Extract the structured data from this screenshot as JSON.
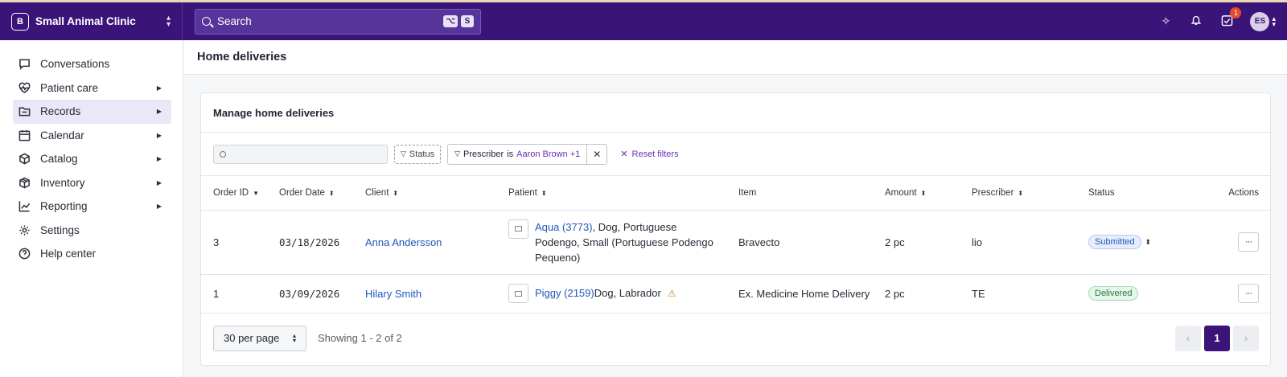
{
  "brand": {
    "logo": "B",
    "name": "Small Animal Clinic"
  },
  "search": {
    "placeholder": "Search",
    "shortcut": [
      "⌥",
      "S"
    ]
  },
  "topbar": {
    "tasks_badge": "1",
    "avatar_initials": "ES"
  },
  "sidebar": {
    "items": [
      {
        "label": "Conversations",
        "icon": "chat-icon",
        "has_submenu": false
      },
      {
        "label": "Patient care",
        "icon": "heart-pulse-icon",
        "has_submenu": true
      },
      {
        "label": "Records",
        "icon": "records-icon",
        "has_submenu": true,
        "active": true
      },
      {
        "label": "Calendar",
        "icon": "calendar-icon",
        "has_submenu": true
      },
      {
        "label": "Catalog",
        "icon": "catalog-icon",
        "has_submenu": true
      },
      {
        "label": "Inventory",
        "icon": "inventory-icon",
        "has_submenu": true
      },
      {
        "label": "Reporting",
        "icon": "chart-icon",
        "has_submenu": true
      },
      {
        "label": "Settings",
        "icon": "gear-icon",
        "has_submenu": false
      },
      {
        "label": "Help center",
        "icon": "help-icon",
        "has_submenu": false
      }
    ]
  },
  "page": {
    "title": "Home deliveries"
  },
  "card": {
    "title": "Manage home deliveries"
  },
  "filters": {
    "search_value": "",
    "status_label": "Status",
    "chip_field": "Prescriber",
    "chip_op": "is",
    "chip_value": "Aaron Brown +1",
    "reset_label": "Reset filters"
  },
  "table": {
    "columns": [
      "Order ID",
      "Order Date",
      "Client",
      "Patient",
      "Item",
      "Amount",
      "Prescriber",
      "Status",
      "Actions"
    ],
    "rows": [
      {
        "order_id": "3",
        "order_date": "03/18/2026",
        "client": "Anna Andersson",
        "patient_link": "Aqua (3773)",
        "patient_details": ", Dog, Portuguese Podengo, Small (Portuguese Podengo Pequeno)",
        "item": "Bravecto",
        "amount": "2 pc",
        "prescriber": "lio",
        "status": "Submitted"
      },
      {
        "order_id": "1",
        "order_date": "03/09/2026",
        "client": "Hilary Smith",
        "patient_link": "Piggy (2159)",
        "patient_details": "Dog, Labrador",
        "item": "Ex. Medicine Home Delivery",
        "amount": "2 pc",
        "prescriber": "TE",
        "status": "Delivered"
      }
    ]
  },
  "footer": {
    "per_page": "30 per page",
    "showing": "Showing 1 - 2 of 2",
    "current_page": "1"
  },
  "colors": {
    "brand": "#3b1479",
    "link": "#2157b8",
    "accent": "#6b2fb0"
  }
}
